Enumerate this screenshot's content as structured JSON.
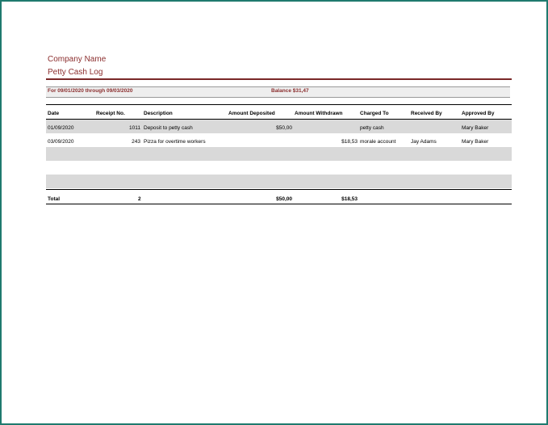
{
  "header": {
    "company": "Company Name",
    "title": "Petty Cash Log",
    "period": "For 09/01/2020 through 09/03/2020",
    "balance": "Balance  $31,47"
  },
  "columns": [
    "Date",
    "Receipt No.",
    "Description",
    "Amount Deposited",
    "Amount Withdrawn",
    "Charged To",
    "Received By",
    "Approved By"
  ],
  "rows": [
    {
      "date": "01/09/2020",
      "receipt": "1011",
      "description": "Deposit to petty cash",
      "deposited": "$50,00",
      "withdrawn": "",
      "charged_to": "petty cash",
      "received_by": "",
      "approved_by": "Mary Baker"
    },
    {
      "date": "03/09/2020",
      "receipt": "243",
      "description": "Pizza for overtime workers",
      "deposited": "",
      "withdrawn": "$18,53",
      "charged_to": "morale account",
      "received_by": "Jay Adams",
      "approved_by": "Mary Baker"
    }
  ],
  "totals": {
    "label": "Total",
    "receipt_count": "2",
    "deposited": "$50,00",
    "withdrawn": "$18,53"
  },
  "colors": {
    "accent": "#8b2e2e",
    "frame": "#1f7a6e",
    "band": "#d9d9d9"
  }
}
